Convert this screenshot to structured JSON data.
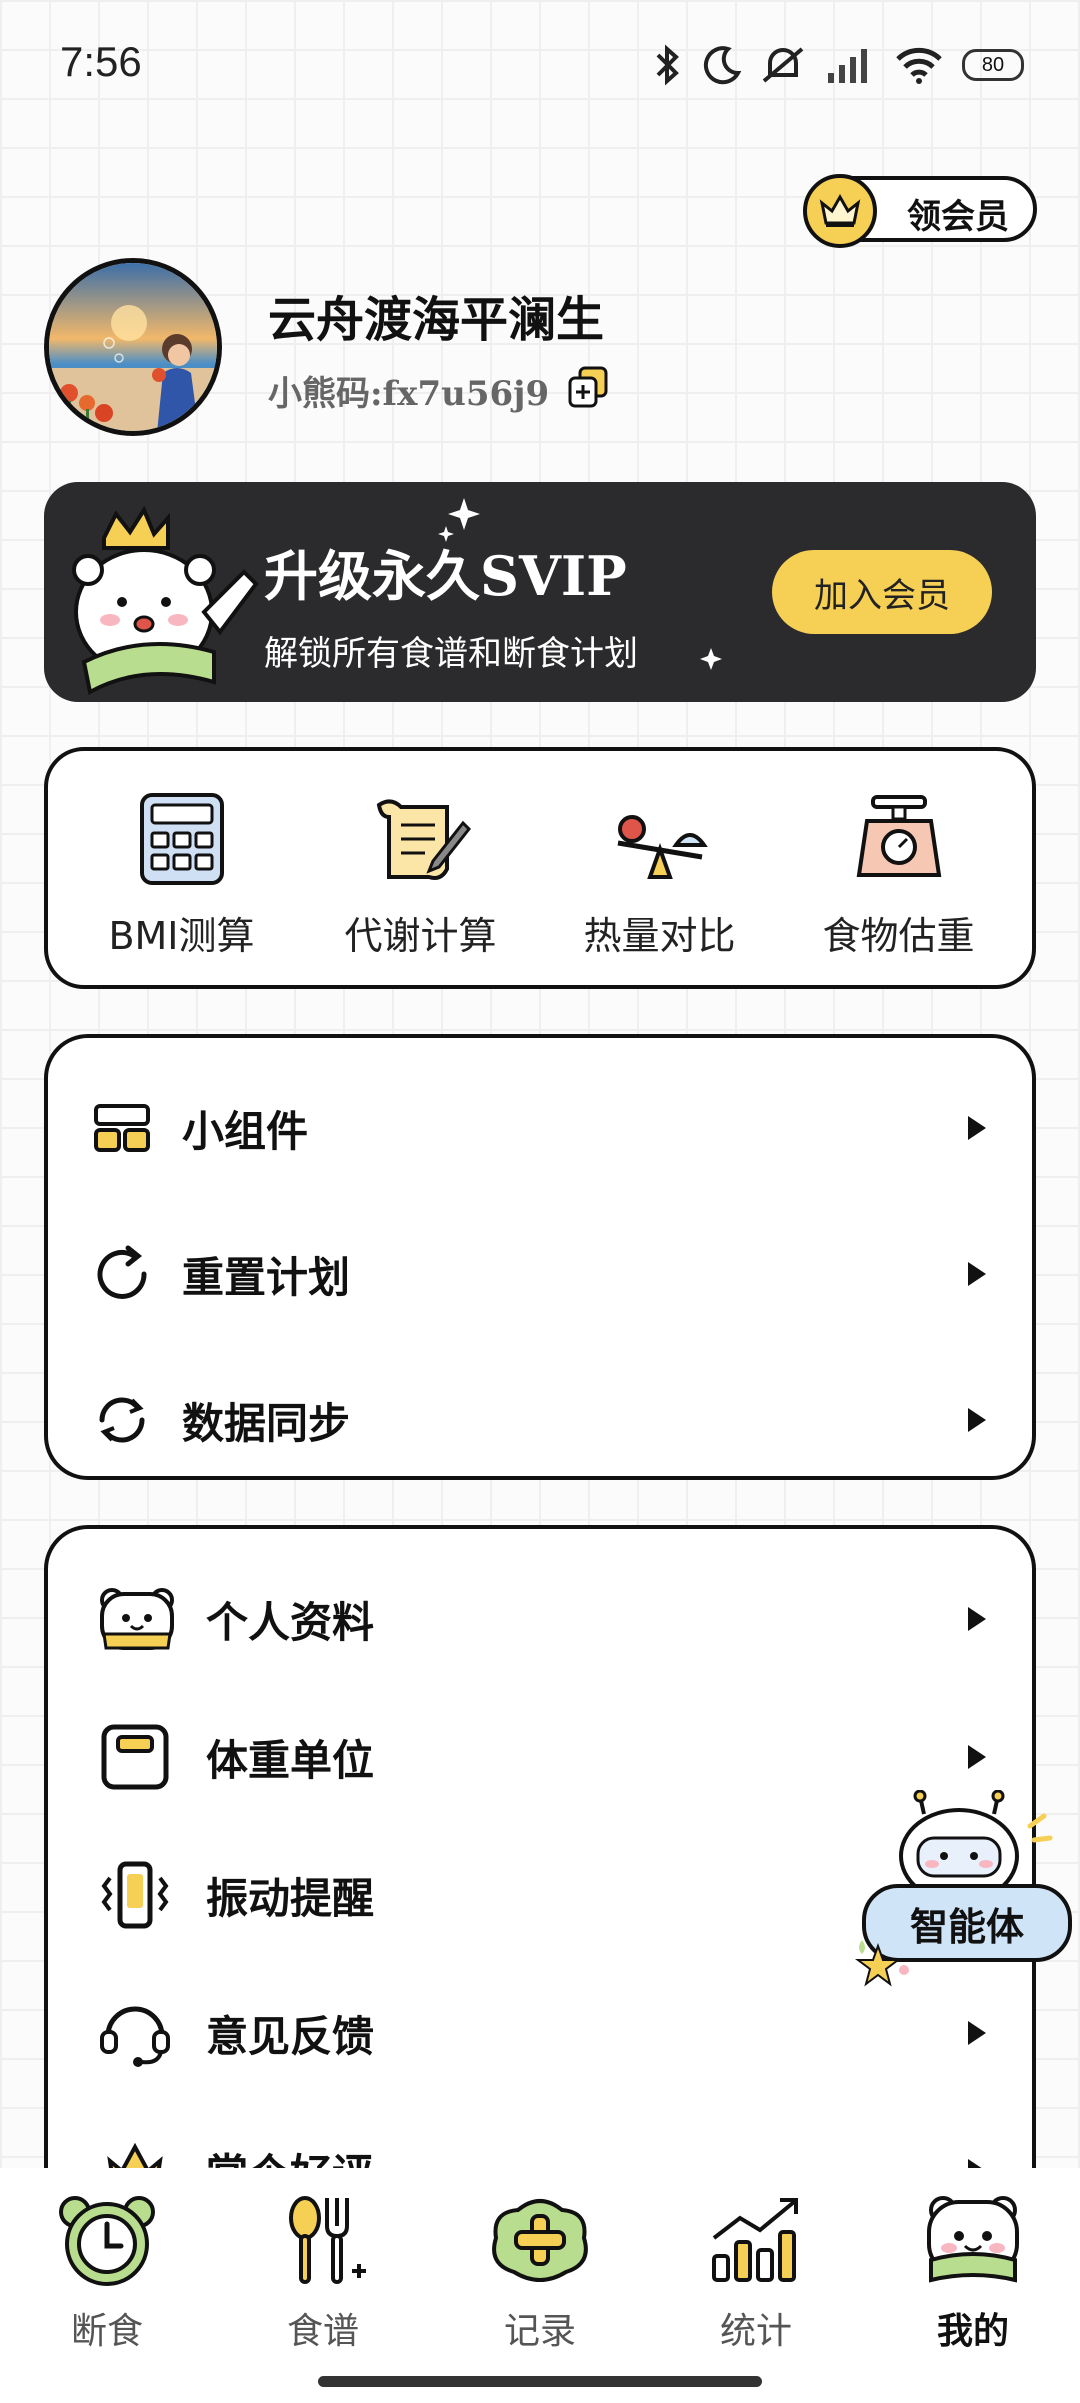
{
  "status_bar": {
    "time": "7:56",
    "battery": "80",
    "icons": [
      "bluetooth-icon",
      "moon-icon",
      "mute-icon",
      "signal-icon",
      "wifi-icon",
      "battery-icon"
    ]
  },
  "header": {
    "vip_label": "领会员"
  },
  "profile": {
    "username": "云舟渡海平澜生",
    "code": "小熊码:fx7u56j9"
  },
  "banner": {
    "title": "升级永久SVIP",
    "subtitle": "解锁所有食谱和断食计划",
    "button": "加入会员"
  },
  "tools": [
    {
      "label": "BMI测算",
      "icon": "calculator-icon"
    },
    {
      "label": "代谢计算",
      "icon": "scroll-pen-icon"
    },
    {
      "label": "热量对比",
      "icon": "balance-scale-icon"
    },
    {
      "label": "食物估重",
      "icon": "kitchen-scale-icon"
    }
  ],
  "menu1": [
    {
      "label": "小组件",
      "icon": "widget-icon"
    },
    {
      "label": "重置计划",
      "icon": "reset-icon"
    },
    {
      "label": "数据同步",
      "icon": "sync-icon"
    }
  ],
  "menu2": [
    {
      "label": "个人资料",
      "icon": "bear-face-icon"
    },
    {
      "label": "体重单位",
      "icon": "scale-icon"
    },
    {
      "label": "振动提醒",
      "icon": "vibrate-icon"
    },
    {
      "label": "意见反馈",
      "icon": "headset-icon"
    },
    {
      "label": "赏个好评",
      "icon": "flower-icon"
    }
  ],
  "agent": {
    "label": "智能体"
  },
  "bottom_nav": [
    {
      "label": "断食",
      "icon": "alarm-clock-icon"
    },
    {
      "label": "食谱",
      "icon": "spoon-fork-icon"
    },
    {
      "label": "记录",
      "icon": "plus-cloud-icon"
    },
    {
      "label": "统计",
      "icon": "chart-icon"
    },
    {
      "label": "我的",
      "icon": "bear-icon",
      "active": true
    }
  ],
  "colors": {
    "accent": "#f6cf55",
    "dark": "#2b2b2d",
    "agent_bg": "#cfe4f7"
  }
}
